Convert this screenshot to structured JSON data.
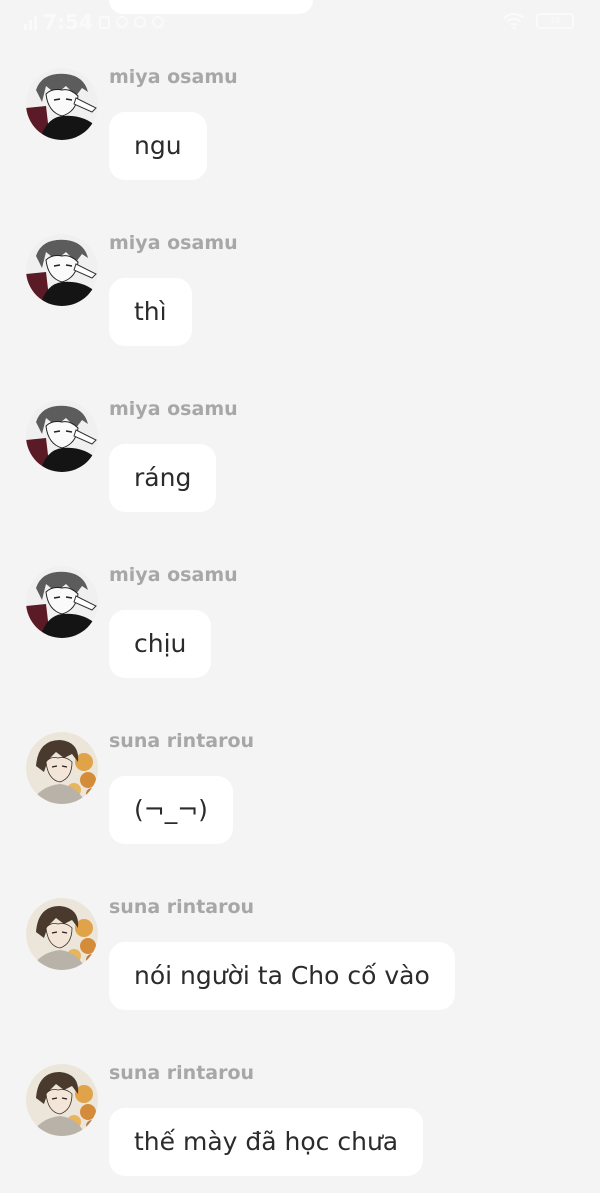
{
  "status_bar": {
    "time": "7:54",
    "battery": "38"
  },
  "messages": [
    {
      "sender": "miya osamu",
      "text": "ngu",
      "avatar": "osamu"
    },
    {
      "sender": "miya osamu",
      "text": "thì",
      "avatar": "osamu"
    },
    {
      "sender": "miya osamu",
      "text": "ráng",
      "avatar": "osamu"
    },
    {
      "sender": "miya osamu",
      "text": "chịu",
      "avatar": "osamu"
    },
    {
      "sender": "suna rintarou",
      "text": "(¬_¬)",
      "avatar": "suna"
    },
    {
      "sender": "suna rintarou",
      "text": "nói người ta Cho cố vào",
      "avatar": "suna"
    },
    {
      "sender": "suna rintarou",
      "text": "thế mày đã học chưa",
      "avatar": "suna"
    }
  ],
  "colors": {
    "background": "#f4f4f4",
    "bubble": "#ffffff",
    "sender_name": "#a7a7a7",
    "message_text": "#2b2b2b"
  }
}
